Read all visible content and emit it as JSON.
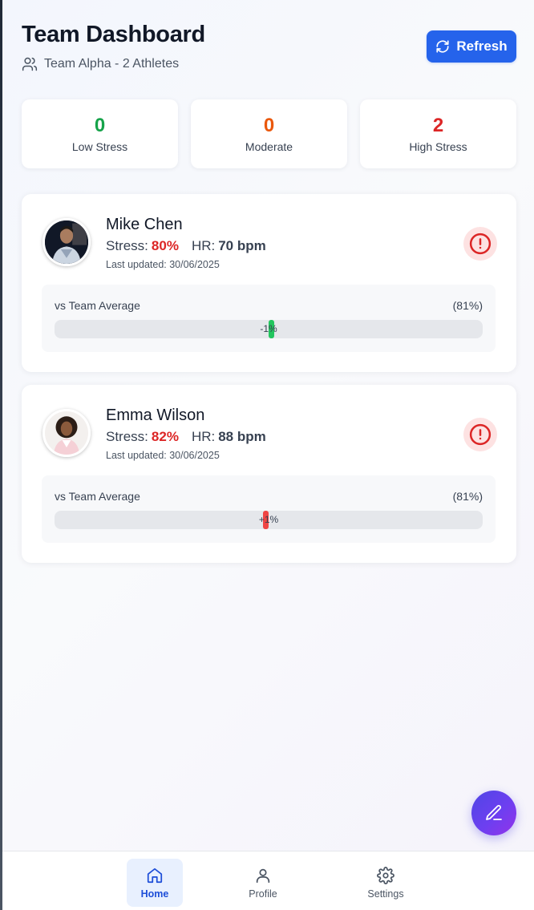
{
  "header": {
    "title": "Team Dashboard",
    "subtitle": "Team Alpha - 2 Athletes",
    "refresh_label": "Refresh"
  },
  "stats": [
    {
      "value": "0",
      "label": "Low Stress",
      "color": "#16a34a"
    },
    {
      "value": "0",
      "label": "Moderate",
      "color": "#ea580c"
    },
    {
      "value": "2",
      "label": "High Stress",
      "color": "#dc2626"
    }
  ],
  "athletes": [
    {
      "name": "Mike Chen",
      "stress_label": "Stress:",
      "stress_value": "80%",
      "hr_label": "HR:",
      "hr_value": "70 bpm",
      "updated": "Last updated: 30/06/2025",
      "compare_label": "vs Team Average",
      "team_avg": "(81%)",
      "diff_label": "-1%",
      "diff_value": -1,
      "bar_color": "#22c55e"
    },
    {
      "name": "Emma Wilson",
      "stress_label": "Stress:",
      "stress_value": "82%",
      "hr_label": "HR:",
      "hr_value": "88 bpm",
      "updated": "Last updated: 30/06/2025",
      "compare_label": "vs Team Average",
      "team_avg": "(81%)",
      "diff_label": "+1%",
      "diff_value": 1,
      "bar_color": "#ef4444"
    }
  ],
  "nav": {
    "items": [
      {
        "label": "Home",
        "icon": "home-icon",
        "active": true
      },
      {
        "label": "Profile",
        "icon": "user-icon",
        "active": false
      },
      {
        "label": "Settings",
        "icon": "gear-icon",
        "active": false
      }
    ]
  },
  "colors": {
    "accent": "#2563eb",
    "alert": "#dc2626"
  }
}
